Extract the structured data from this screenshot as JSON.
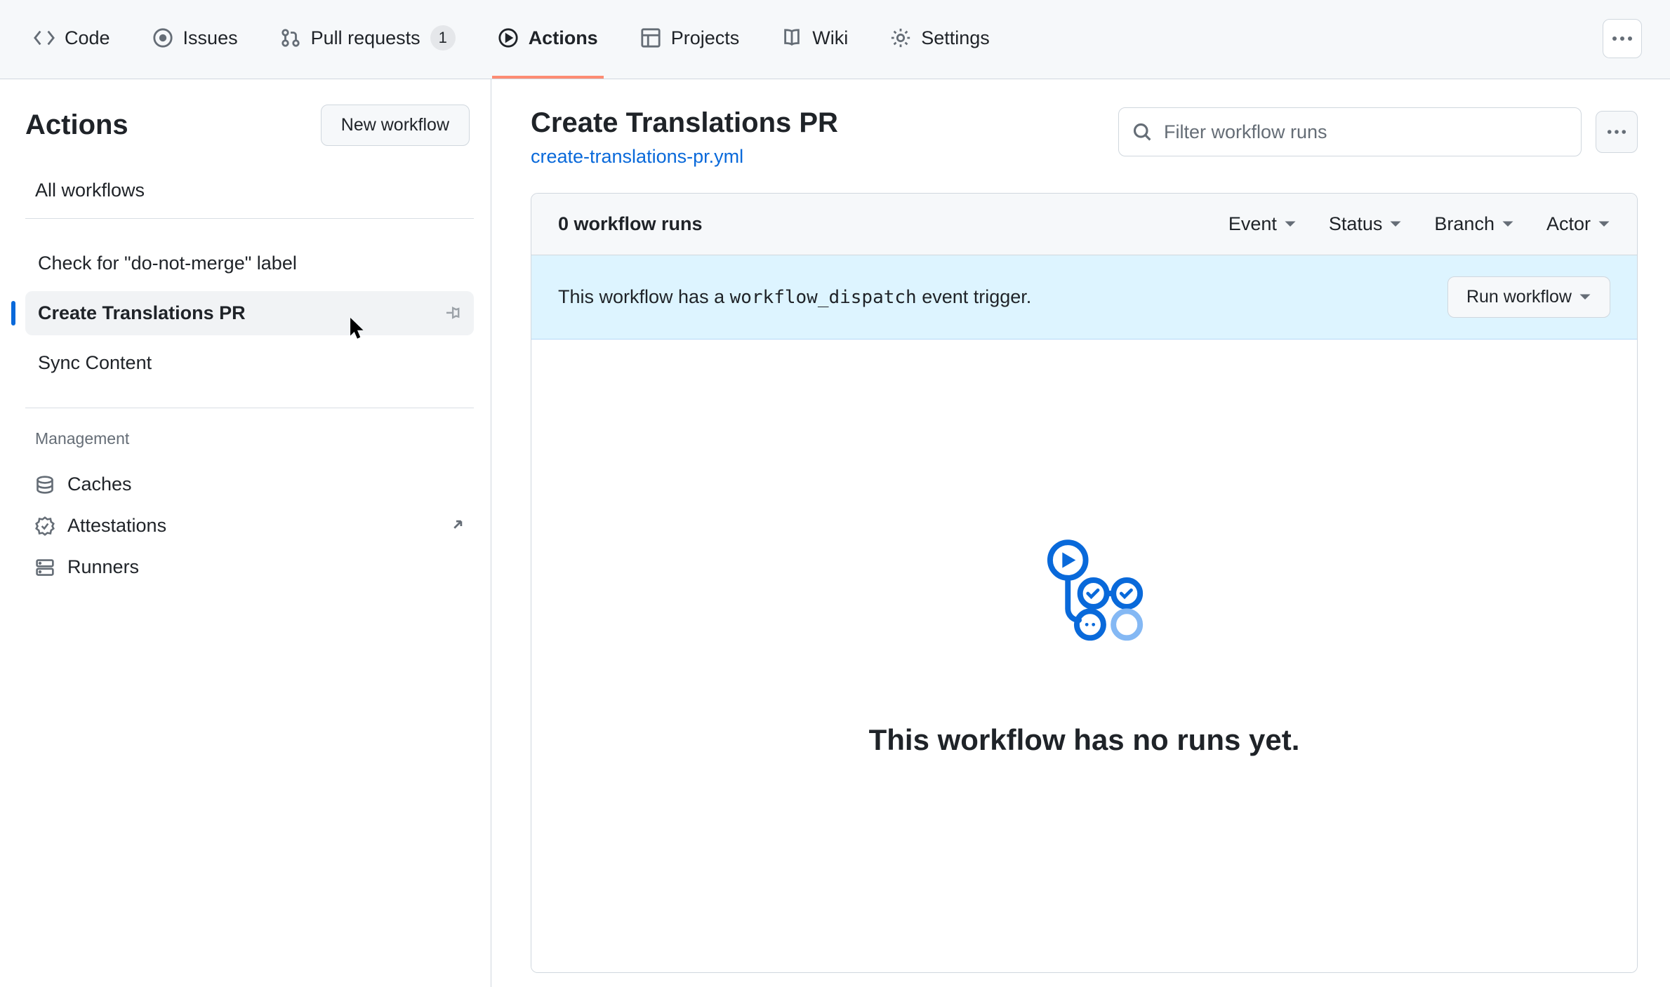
{
  "nav": {
    "tabs": [
      {
        "label": "Code"
      },
      {
        "label": "Issues"
      },
      {
        "label": "Pull requests",
        "count": "1"
      },
      {
        "label": "Actions",
        "active": true
      },
      {
        "label": "Projects"
      },
      {
        "label": "Wiki"
      },
      {
        "label": "Settings"
      }
    ]
  },
  "sidebar": {
    "title": "Actions",
    "new_workflow_label": "New workflow",
    "all_workflows_label": "All workflows",
    "workflows": [
      {
        "label": "Check for \"do-not-merge\" label"
      },
      {
        "label": "Create Translations PR",
        "active": true
      },
      {
        "label": "Sync Content"
      }
    ],
    "management_label": "Management",
    "management": [
      {
        "label": "Caches"
      },
      {
        "label": "Attestations",
        "external": true
      },
      {
        "label": "Runners"
      }
    ]
  },
  "main": {
    "workflow_title": "Create Translations PR",
    "workflow_file": "create-translations-pr.yml",
    "filter_placeholder": "Filter workflow runs",
    "runs_count": "0 workflow runs",
    "filters": [
      {
        "label": "Event"
      },
      {
        "label": "Status"
      },
      {
        "label": "Branch"
      },
      {
        "label": "Actor"
      }
    ],
    "dispatch_text_pre": "This workflow has a ",
    "dispatch_code": "workflow_dispatch",
    "dispatch_text_post": " event trigger.",
    "run_workflow_label": "Run workflow",
    "empty_title": "This workflow has no runs yet."
  }
}
